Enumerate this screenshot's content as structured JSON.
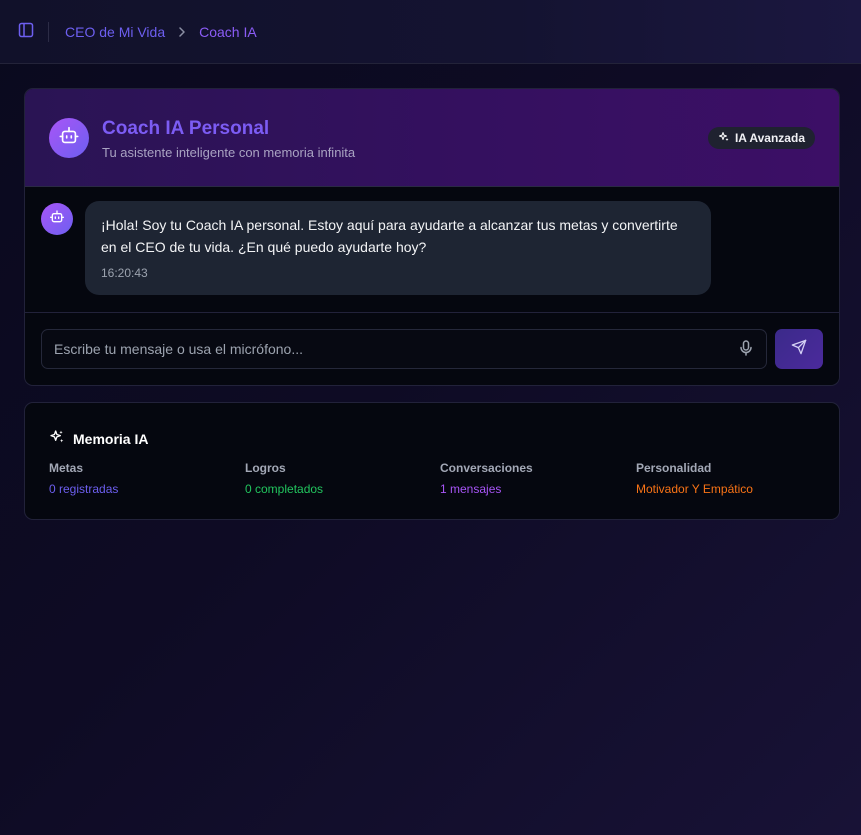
{
  "breadcrumb": {
    "parent": "CEO de Mi Vida",
    "current": "Coach IA"
  },
  "coach": {
    "title": "Coach IA Personal",
    "subtitle": "Tu asistente inteligente con memoria infinita",
    "badge": "IA Avanzada"
  },
  "messages": [
    {
      "sender": "coach",
      "text": "¡Hola! Soy tu Coach IA personal. Estoy aquí para ayudarte a alcanzar tus metas y convertirte en el CEO de tu vida. ¿En qué puedo ayudarte hoy?",
      "time": "16:20:43"
    }
  ],
  "composer": {
    "placeholder": "Escribe tu mensaje o usa el micrófono...",
    "value": ""
  },
  "memory": {
    "title": "Memoria IA",
    "items": [
      {
        "label": "Metas",
        "value": "0 registradas",
        "color": "#6d5ff0"
      },
      {
        "label": "Logros",
        "value": "0 completados",
        "color": "#22c55e"
      },
      {
        "label": "Conversaciones",
        "value": "1 mensajes",
        "color": "#a855f7"
      },
      {
        "label": "Personalidad",
        "value": "Motivador Y Empático",
        "color": "#f97316"
      }
    ]
  },
  "icons": {
    "sidebar_toggle": "sidebar-panel-icon",
    "breadcrumb_separator": "chevron-right-icon",
    "coach_avatar": "robot-icon",
    "badge": "sparkles-icon",
    "mic": "microphone-icon",
    "send": "send-icon",
    "memory": "sparkles-icon"
  },
  "colors": {
    "accent": "#6d5ff0",
    "header_gradient_start": "#2a1454",
    "header_gradient_end": "#3c0f66",
    "bubble": "#1e2533"
  }
}
